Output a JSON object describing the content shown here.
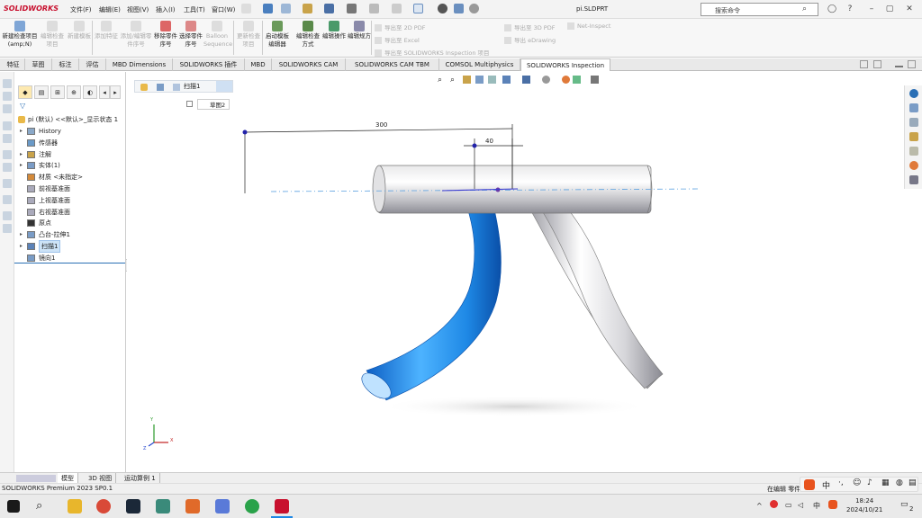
{
  "app": {
    "name": "SOLIDWORKS",
    "doc_title": "pi.SLDPRT"
  },
  "menu": [
    "文件(F)",
    "编辑(E)",
    "视图(V)",
    "插入(I)",
    "工具(T)",
    "窗口(W)"
  ],
  "search": {
    "placeholder": "搜索命令"
  },
  "ribbon": {
    "buttons": [
      {
        "label": "新建检查项目(amp;N)",
        "enabled": true
      },
      {
        "label": "编辑检查项目",
        "enabled": false
      },
      {
        "label": "新建模板",
        "enabled": false
      },
      {
        "label": "添加特征",
        "enabled": false
      },
      {
        "label": "添加/编辑零件序号",
        "enabled": false
      },
      {
        "label": "移除零件序号",
        "enabled": true
      },
      {
        "label": "选择零件序号",
        "enabled": true
      },
      {
        "label": "Balloon Sequence",
        "enabled": false
      },
      {
        "label": "更新检查项目",
        "enabled": false
      },
      {
        "label": "启动模板编辑器",
        "enabled": true
      },
      {
        "label": "编辑检查方式",
        "enabled": true
      },
      {
        "label": "编辑操作",
        "enabled": true
      },
      {
        "label": "编辑规方",
        "enabled": true
      }
    ],
    "exports": [
      "导出至 2D PDF",
      "导出至 Excel",
      "导出至 SOLIDWORKS Inspection 项目",
      "导出至 3D PDF",
      "导出 eDrawing",
      "Net-Inspect"
    ]
  },
  "tabs": [
    "特征",
    "草图",
    "标注",
    "评估",
    "MBD Dimensions",
    "SOLIDWORKS 插件",
    "MBD",
    "SOLIDWORKS CAM",
    "SOLIDWORKS CAM TBM",
    "COMSOL Multiphysics",
    "SOLIDWORKS Inspection"
  ],
  "active_tab": "SOLIDWORKS Inspection",
  "tree": {
    "root": "pi (默认) <<默认>_显示状态 1",
    "items": [
      {
        "label": "History",
        "expand": true
      },
      {
        "label": "传感器",
        "expand": false
      },
      {
        "label": "注解",
        "expand": true
      },
      {
        "label": "实体(1)",
        "expand": true
      },
      {
        "label": "材质 <未指定>",
        "expand": false
      },
      {
        "label": "前视基准面",
        "expand": false
      },
      {
        "label": "上视基准面",
        "expand": false
      },
      {
        "label": "右视基准面",
        "expand": false
      },
      {
        "label": "原点",
        "expand": false
      },
      {
        "label": "凸台-拉伸1",
        "expand": true
      },
      {
        "label": "扫描1",
        "expand": true,
        "selected": true
      },
      {
        "label": "镜向1",
        "expand": false
      }
    ]
  },
  "breadcrumb": {
    "feature": "扫描1",
    "sketch": "草图2"
  },
  "dimensions": {
    "d1": "300",
    "d2": "40"
  },
  "triad": {
    "x": "X",
    "y": "Y",
    "z": "Z"
  },
  "bottom_tabs": [
    "模型",
    "3D 视图",
    "运动算例 1"
  ],
  "status": {
    "left": "SOLIDWORKS Premium 2023 SP0.1",
    "right": "在编辑 零件"
  },
  "clock": {
    "time": "18:24",
    "date": "2024/10/21"
  },
  "tray": {
    "ime": "中",
    "badge": "2"
  },
  "colors": {
    "accent": "#1e88e5",
    "selected_body": "#1976d2",
    "brand": "#c8102e"
  }
}
